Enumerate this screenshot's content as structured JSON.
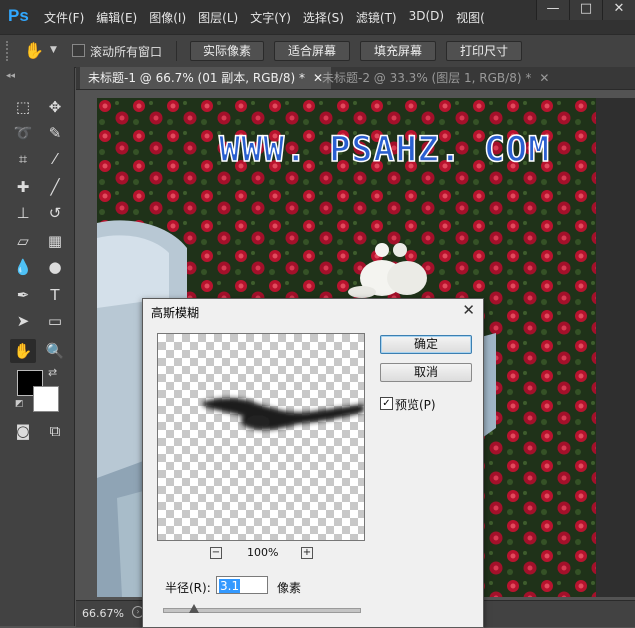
{
  "app": {
    "logo": "Ps"
  },
  "menu": [
    "文件(F)",
    "编辑(E)",
    "图像(I)",
    "图层(L)",
    "文字(Y)",
    "选择(S)",
    "滤镜(T)",
    "3D(D)",
    "视图("
  ],
  "window_controls": {
    "minimize": "—",
    "restore": "□",
    "close": "✕"
  },
  "options_bar": {
    "scroll_all_label": "滚动所有窗口",
    "scroll_all_checked": false,
    "buttons": [
      "实际像素",
      "适合屏幕",
      "填充屏幕",
      "打印尺寸"
    ]
  },
  "toolbox": {
    "collapse_label": "◂◂",
    "tools": [
      "rectangular-marquee-icon",
      "move-icon",
      "lasso-icon",
      "quick-selection-icon",
      "crop-icon",
      "eyedropper-icon",
      "healing-brush-icon",
      "brush-icon",
      "clone-stamp-icon",
      "history-brush-icon",
      "eraser-icon",
      "gradient-icon",
      "blur-icon",
      "dodge-icon",
      "pen-icon",
      "type-icon",
      "path-selection-icon",
      "rectangle-shape-icon",
      "hand-icon",
      "zoom-icon",
      "quick-mask-icon",
      "screen-mode-icon"
    ],
    "foreground_color": "#000000",
    "background_color": "#ffffff"
  },
  "tabs": [
    {
      "label": "未标题-1 @ 66.7% (01 副本, RGB/8) *",
      "active": true
    },
    {
      "label": "未标题-2 @ 33.3% (图层 1, RGB/8) *",
      "active": false
    }
  ],
  "canvas": {
    "watermark": "WWW. PSAHZ. COM"
  },
  "status": {
    "zoom": "66.67%"
  },
  "dialog": {
    "title": "高斯模糊",
    "ok_label": "确定",
    "cancel_label": "取消",
    "preview_label": "预览(P)",
    "preview_checked": true,
    "zoom_level": "100%",
    "zoom_minus": "−",
    "zoom_plus": "+",
    "radius_label": "半径(R):",
    "radius_value": "3.1",
    "radius_unit": "像素",
    "radius_slider_fraction": 0.16
  }
}
